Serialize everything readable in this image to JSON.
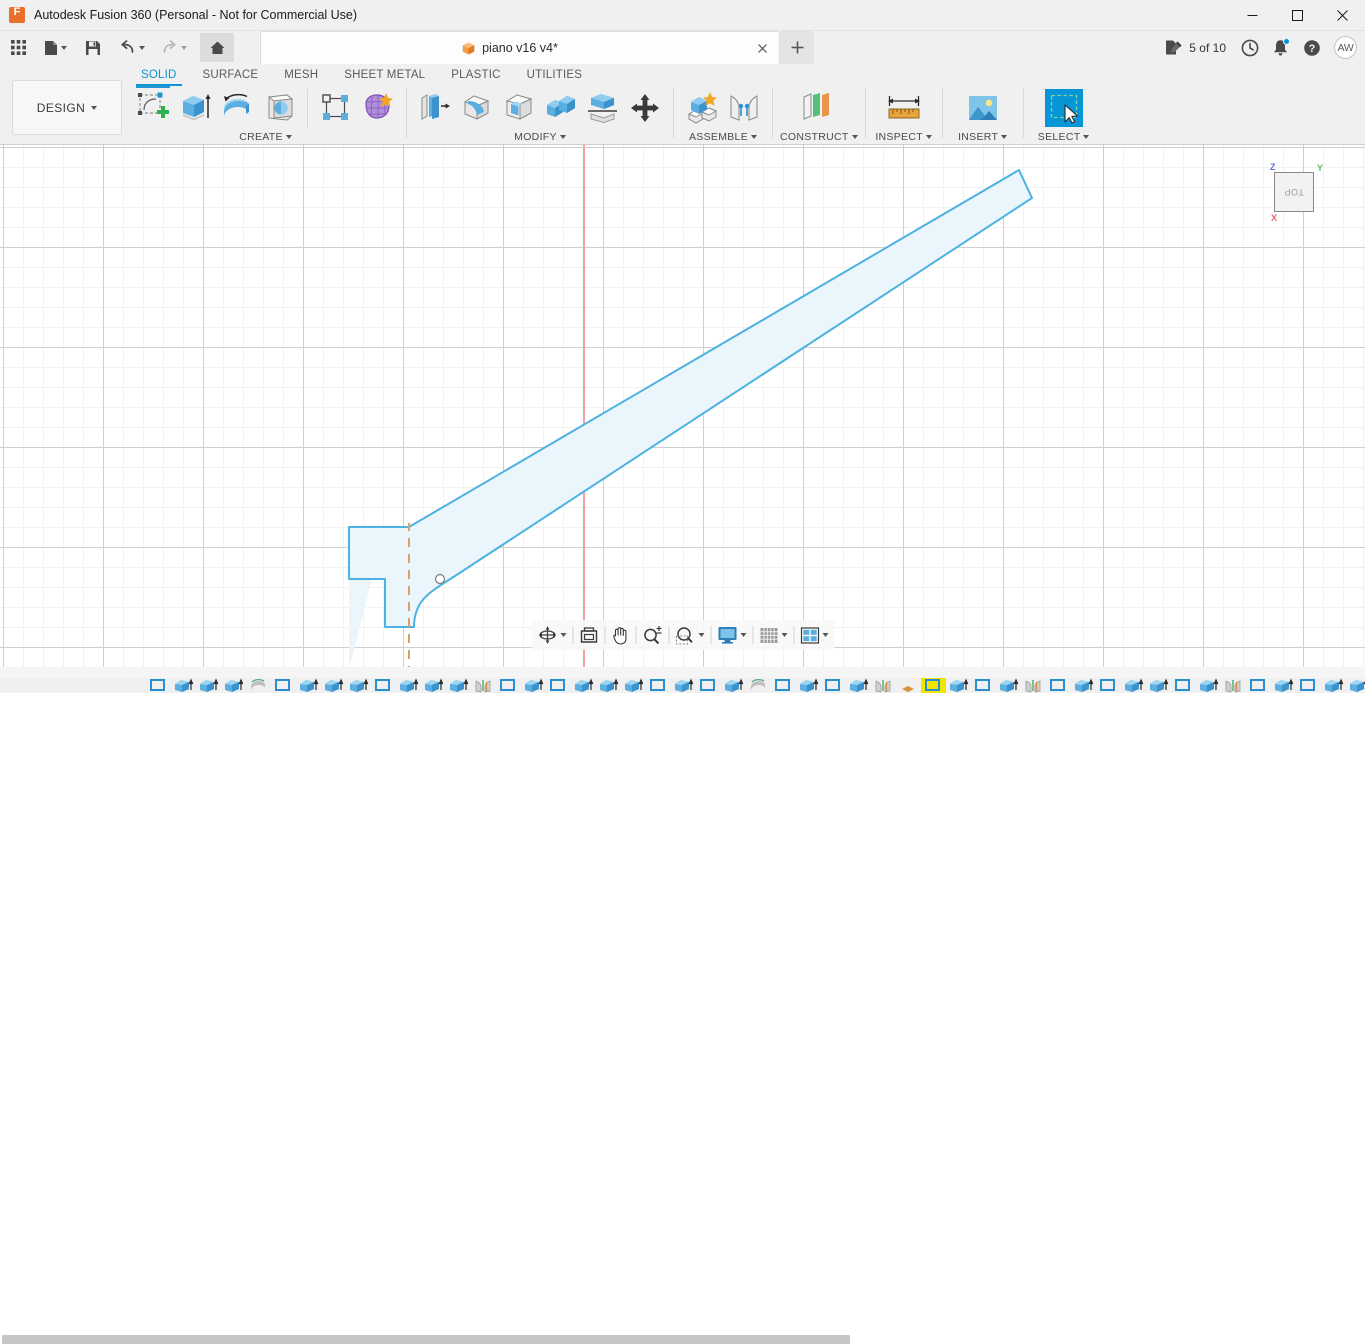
{
  "window": {
    "title": "Autodesk Fusion 360 (Personal - Not for Commercial Use)",
    "app_icon": "fusion-logo-icon",
    "minimize_label": "—",
    "maximize_label": "□",
    "close_label": "✕"
  },
  "quick_access": {
    "grid_menu": "app-grid-icon",
    "file": "file-icon",
    "save": "save-icon",
    "undo": "undo-icon",
    "redo": "redo-icon",
    "home": "home-icon"
  },
  "document_tab": {
    "label": "piano v16 v4*",
    "icon": "cube-icon",
    "close_label": "✕",
    "new_tab_label": "+"
  },
  "status_right": {
    "jobs_label": "5 of 10",
    "jobs_icon": "jobs-document-icon",
    "recent_icon": "clock-icon",
    "notifications_icon": "bell-icon",
    "help_icon": "help-icon",
    "avatar_initials": "AW",
    "notification_dot_color": "#0696d7"
  },
  "workspace": {
    "design_label": "DESIGN",
    "accent_color": "#0696d7"
  },
  "ribbon_tabs": [
    {
      "label": "SOLID",
      "active": true
    },
    {
      "label": "SURFACE",
      "active": false
    },
    {
      "label": "MESH",
      "active": false
    },
    {
      "label": "SHEET METAL",
      "active": false
    },
    {
      "label": "PLASTIC",
      "active": false
    },
    {
      "label": "UTILITIES",
      "active": false
    }
  ],
  "panels": [
    {
      "label": "CREATE",
      "has_dropdown": true,
      "tools": [
        {
          "name": "create-sketch-tool",
          "highlighted": true
        },
        {
          "name": "extrude-tool",
          "highlighted": false
        },
        {
          "name": "revolve-tool",
          "highlighted": false
        },
        {
          "name": "sweep-tool",
          "highlighted": false
        },
        {
          "name": "pattern-tool",
          "highlighted": false
        },
        {
          "name": "mesh-body-tool",
          "highlighted": false
        }
      ]
    },
    {
      "label": "MODIFY",
      "has_dropdown": true,
      "tools": [
        {
          "name": "press-pull-tool",
          "highlighted": false
        },
        {
          "name": "fillet-tool",
          "highlighted": false
        },
        {
          "name": "shell-tool",
          "highlighted": false
        },
        {
          "name": "combine-tool",
          "highlighted": false
        },
        {
          "name": "split-body-tool",
          "highlighted": false
        },
        {
          "name": "move-copy-tool",
          "highlighted": false
        }
      ]
    },
    {
      "label": "ASSEMBLE",
      "has_dropdown": true,
      "tools": [
        {
          "name": "new-component-tool",
          "highlighted": false
        },
        {
          "name": "joint-tool",
          "highlighted": false
        }
      ]
    },
    {
      "label": "CONSTRUCT",
      "has_dropdown": true,
      "tools": [
        {
          "name": "offset-plane-tool",
          "highlighted": false
        }
      ]
    },
    {
      "label": "INSPECT",
      "has_dropdown": true,
      "tools": [
        {
          "name": "measure-tool",
          "highlighted": false
        }
      ]
    },
    {
      "label": "INSERT",
      "has_dropdown": true,
      "tools": [
        {
          "name": "insert-image-tool",
          "highlighted": false
        }
      ]
    },
    {
      "label": "SELECT",
      "has_dropdown": true,
      "tools": [
        {
          "name": "select-tool",
          "highlighted": false,
          "active": true
        }
      ]
    }
  ],
  "viewcube": {
    "face_label": "TOP",
    "axis_z": "Z",
    "axis_y": "Y",
    "axis_x": "X",
    "z_color": "#5b6fd6",
    "y_color": "#5fbf5f",
    "x_color": "#e06666"
  },
  "canvas": {
    "grid_minor_color": "#f2f2f2",
    "grid_major_color": "#cfcfcf",
    "vertical_axis_color": "#f4a0a0",
    "sketch_stroke_color": "#4db2e0",
    "sketch_fill_color": "#eaf6fc",
    "construction_line_color": "#d9a06a",
    "point_color": "#8a8a8a"
  },
  "navbar": [
    {
      "name": "orbit-tool",
      "has_dropdown": true
    },
    {
      "name": "look-at-tool",
      "has_dropdown": false
    },
    {
      "name": "pan-tool",
      "has_dropdown": false
    },
    {
      "name": "zoom-tool",
      "has_dropdown": false
    },
    {
      "name": "zoom-window-tool",
      "has_dropdown": true
    },
    {
      "name": "display-settings",
      "has_dropdown": true
    },
    {
      "name": "grid-snaps",
      "has_dropdown": true
    },
    {
      "name": "viewports",
      "has_dropdown": true
    }
  ],
  "timeline": {
    "items": [
      {
        "type": "sketch"
      },
      {
        "type": "extrude"
      },
      {
        "type": "extrude"
      },
      {
        "type": "extrude"
      },
      {
        "type": "revolve"
      },
      {
        "type": "sketch"
      },
      {
        "type": "extrude"
      },
      {
        "type": "extrude"
      },
      {
        "type": "extrude"
      },
      {
        "type": "sketch"
      },
      {
        "type": "extrude"
      },
      {
        "type": "extrude"
      },
      {
        "type": "extrude"
      },
      {
        "type": "joint"
      },
      {
        "type": "sketch"
      },
      {
        "type": "extrude"
      },
      {
        "type": "sketch"
      },
      {
        "type": "extrude"
      },
      {
        "type": "extrude"
      },
      {
        "type": "extrude"
      },
      {
        "type": "sketch"
      },
      {
        "type": "extrude"
      },
      {
        "type": "sketch"
      },
      {
        "type": "extrude"
      },
      {
        "type": "revolve"
      },
      {
        "type": "sketch"
      },
      {
        "type": "extrude"
      },
      {
        "type": "sketch"
      },
      {
        "type": "extrude"
      },
      {
        "type": "joint"
      },
      {
        "type": "component"
      },
      {
        "type": "sketch",
        "selected": true
      },
      {
        "type": "extrude"
      },
      {
        "type": "sketch"
      },
      {
        "type": "extrude"
      },
      {
        "type": "joint"
      },
      {
        "type": "sketch"
      },
      {
        "type": "extrude"
      },
      {
        "type": "sketch"
      },
      {
        "type": "extrude"
      },
      {
        "type": "extrude"
      },
      {
        "type": "sketch"
      },
      {
        "type": "extrude"
      },
      {
        "type": "joint"
      },
      {
        "type": "sketch"
      },
      {
        "type": "extrude"
      },
      {
        "type": "sketch"
      },
      {
        "type": "extrude"
      },
      {
        "type": "extrude"
      },
      {
        "type": "extrude"
      }
    ]
  }
}
